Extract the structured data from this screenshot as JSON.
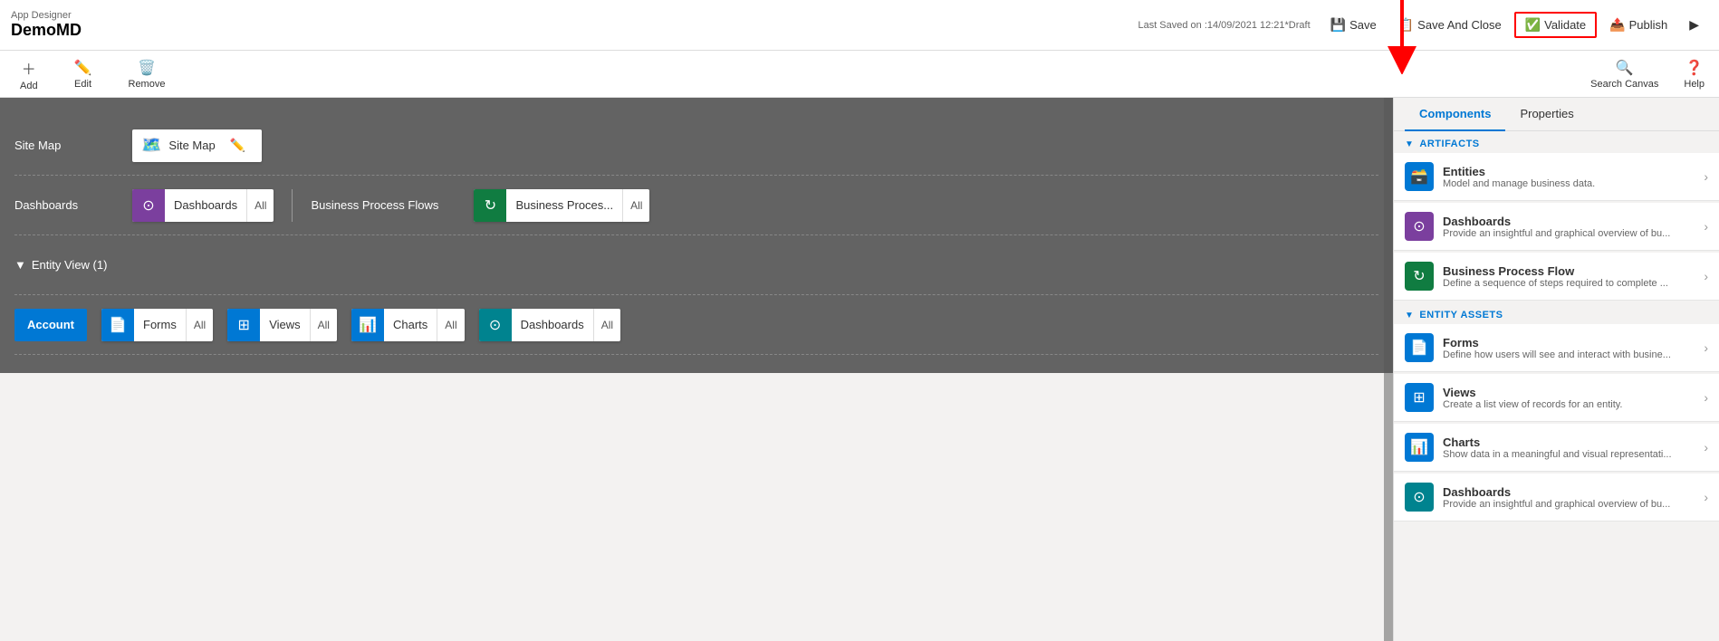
{
  "topBar": {
    "appDesignerLabel": "App Designer",
    "appName": "DemoMD",
    "lastSaved": "Last Saved on :14/09/2021 12:21",
    "draft": "*Draft",
    "saveLabel": "Save",
    "saveAndCloseLabel": "Save And Close",
    "validateLabel": "Validate",
    "publishLabel": "Publish",
    "playLabel": "Play"
  },
  "toolbar": {
    "addLabel": "Add",
    "editLabel": "Edit",
    "removeLabel": "Remove",
    "searchCanvasLabel": "Search Canvas",
    "helpLabel": "Help"
  },
  "canvas": {
    "siteMapLabel": "Site Map",
    "siteMapCardLabel": "Site Map",
    "dashboardsLabel": "Dashboards",
    "dashboardsCardLabel": "Dashboards",
    "dashboardsAll": "All",
    "bpfLabel": "Business Process Flows",
    "bpfCardLabel": "Business Proces...",
    "bpfAll": "All",
    "entityViewLabel": "Entity View (1)",
    "accountLabel": "Account",
    "formsLabel": "Forms",
    "formsAll": "All",
    "viewsLabel": "Views",
    "viewsAll": "All",
    "chartsLabel": "Charts",
    "chartsAll": "All",
    "dashboards2Label": "Dashboards",
    "dashboards2All": "All"
  },
  "rightPanel": {
    "componentsTab": "Components",
    "propertiesTab": "Properties",
    "artifactsHeader": "ARTIFACTS",
    "entities": {
      "title": "Entities",
      "desc": "Model and manage business data."
    },
    "dashboards": {
      "title": "Dashboards",
      "desc": "Provide an insightful and graphical overview of bu..."
    },
    "bpf": {
      "title": "Business Process Flow",
      "desc": "Define a sequence of steps required to complete ..."
    },
    "entityAssetsHeader": "ENTITY ASSETS",
    "forms": {
      "title": "Forms",
      "desc": "Define how users will see and interact with busine..."
    },
    "views": {
      "title": "Views",
      "desc": "Create a list view of records for an entity."
    },
    "charts": {
      "title": "Charts",
      "desc": "Show data in a meaningful and visual representati..."
    },
    "dashboards2": {
      "title": "Dashboards",
      "desc": "Provide an insightful and graphical overview of bu..."
    }
  }
}
